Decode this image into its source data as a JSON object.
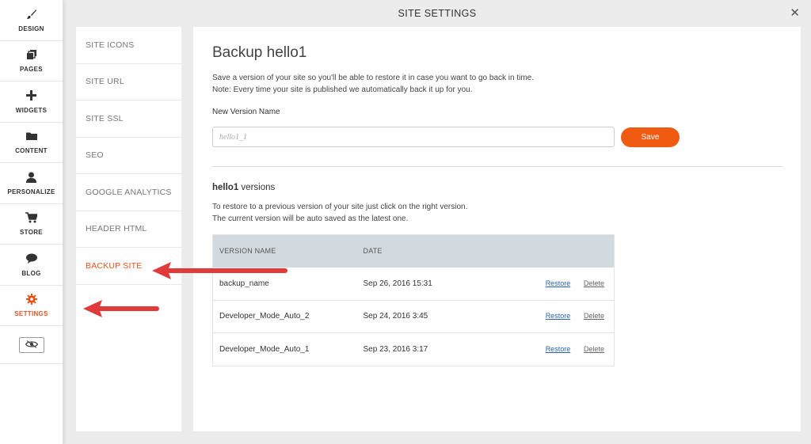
{
  "sidebar": {
    "items": [
      {
        "label": "DESIGN",
        "icon": "brush-icon"
      },
      {
        "label": "PAGES",
        "icon": "pages-icon"
      },
      {
        "label": "WIDGETS",
        "icon": "plus-icon"
      },
      {
        "label": "CONTENT",
        "icon": "folder-icon"
      },
      {
        "label": "PERSONALIZE",
        "icon": "user-icon"
      },
      {
        "label": "STORE",
        "icon": "cart-icon"
      },
      {
        "label": "BLOG",
        "icon": "chat-bubble-icon"
      },
      {
        "label": "SETTINGS",
        "icon": "gear-icon"
      }
    ],
    "active_index": 7
  },
  "header": {
    "title": "SITE SETTINGS"
  },
  "nav": {
    "items": [
      "SITE ICONS",
      "SITE URL",
      "SITE SSL",
      "SEO",
      "GOOGLE ANALYTICS",
      "HEADER HTML",
      "BACKUP SITE"
    ],
    "active_index": 6
  },
  "content": {
    "title": "Backup hello1",
    "desc_line1": "Save a version of your site so you'll be able to restore it in case you want to go back in time.",
    "desc_line2": "Note: Every time your site is published we automatically back it up for you.",
    "field_label": "New Version Name",
    "input_placeholder": "hello1_1",
    "save_label": "Save",
    "versions_site": "hello1",
    "versions_suffix": " versions",
    "desc2_line1": "To restore to a previous version of your site just click on the right version.",
    "desc2_line2": "The current version will be auto saved as the latest one.",
    "table": {
      "headers": [
        "VERSION NAME",
        "DATE"
      ],
      "rows": [
        {
          "name": "backup_name",
          "date": "Sep 26, 2016 15:31",
          "restore": "Restore",
          "delete": "Delete"
        },
        {
          "name": "Developer_Mode_Auto_2",
          "date": "Sep 24, 2016 3:45",
          "restore": "Restore",
          "delete": "Delete"
        },
        {
          "name": "Developer_Mode_Auto_1",
          "date": "Sep 23, 2016 3:17",
          "restore": "Restore",
          "delete": "Delete"
        }
      ]
    }
  },
  "colors": {
    "accent": "#f05b11",
    "active_text": "#e8521c",
    "link": "#2b62b0",
    "table_header": "#d3dadf",
    "annotation_arrow": "#e03a3a"
  }
}
